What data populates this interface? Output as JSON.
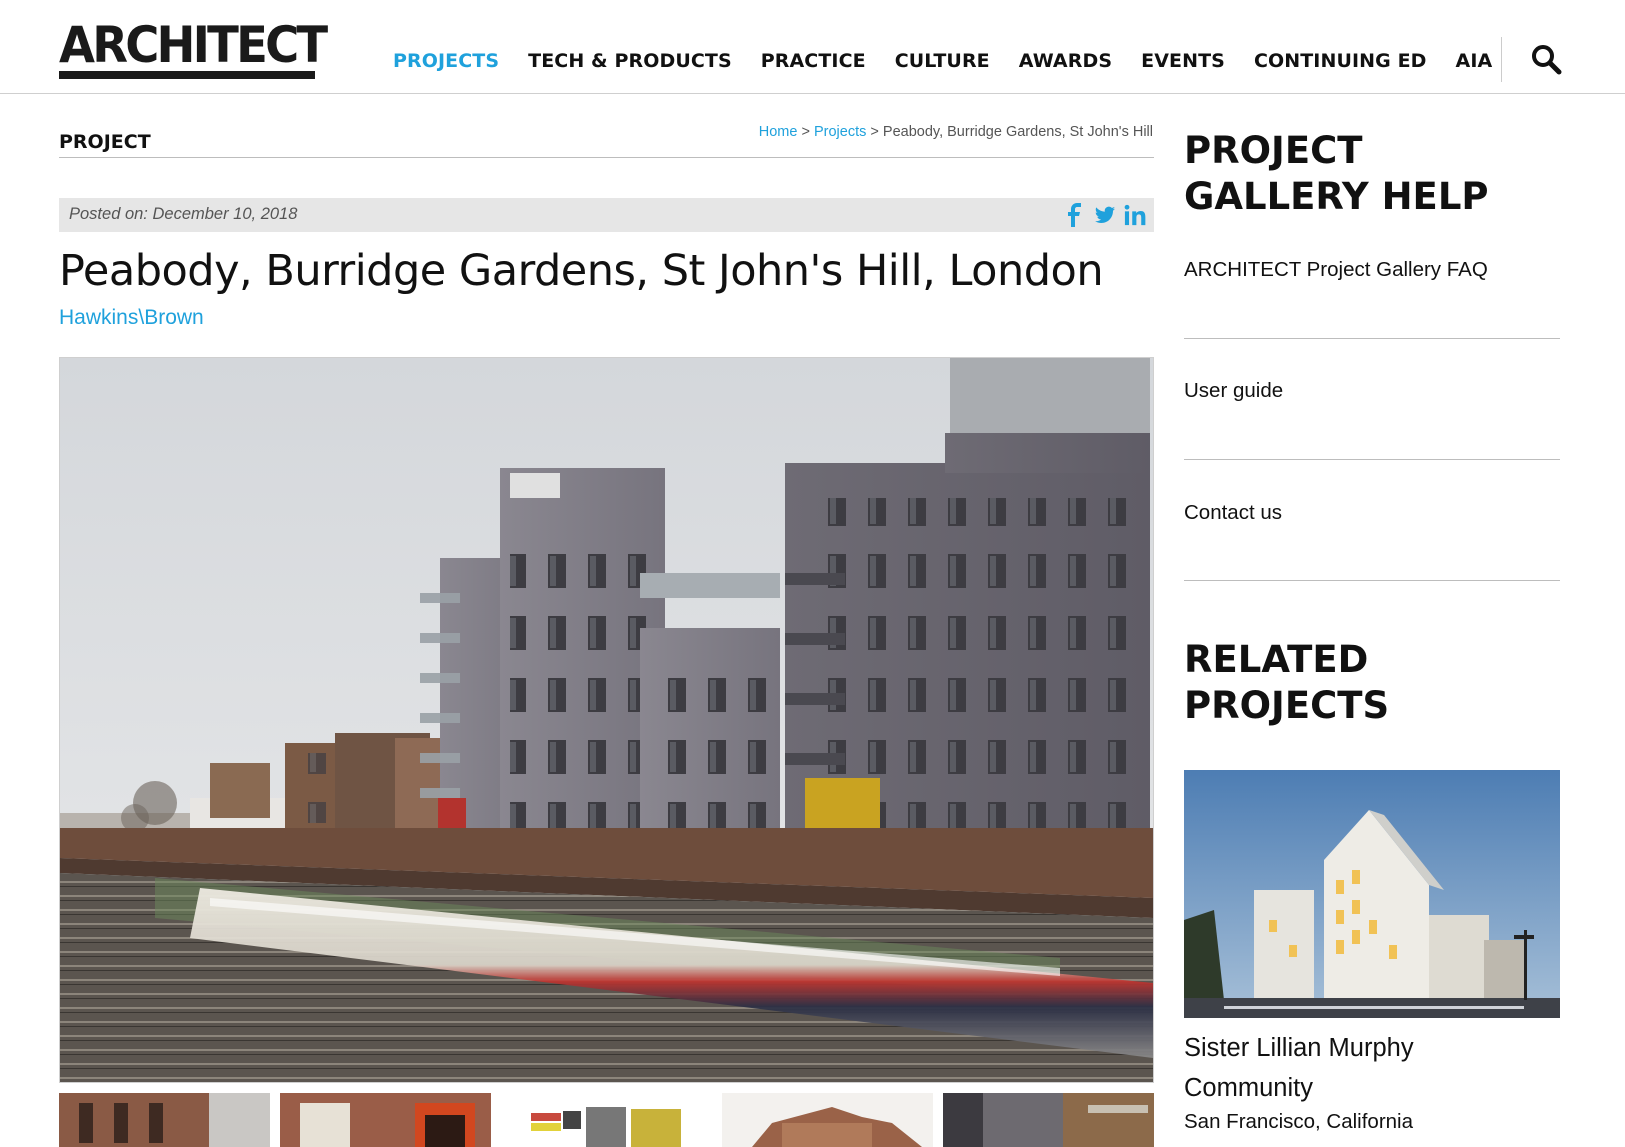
{
  "header": {
    "logo": "ARCHITECT",
    "nav": [
      {
        "label": "PROJECTS",
        "active": true
      },
      {
        "label": "TECH & PRODUCTS",
        "active": false
      },
      {
        "label": "PRACTICE",
        "active": false
      },
      {
        "label": "CULTURE",
        "active": false
      },
      {
        "label": "AWARDS",
        "active": false
      },
      {
        "label": "EVENTS",
        "active": false
      },
      {
        "label": "CONTINUING ED",
        "active": false
      },
      {
        "label": "AIA",
        "active": false
      }
    ],
    "search_icon": "search-icon"
  },
  "main": {
    "section_label": "PROJECT",
    "breadcrumb": {
      "home": "Home",
      "sep1": " > ",
      "projects": "Projects",
      "sep2": " > ",
      "current": "Peabody, Burridge Gardens, St John's Hill"
    },
    "posted": "Posted on: December 10, 2018",
    "share_icons": [
      "facebook-icon",
      "twitter-icon",
      "linkedin-icon"
    ],
    "title": "Peabody, Burridge Gardens, St John's Hill, London",
    "firm": "Hawkins\\Brown",
    "thumbnail_count": 5
  },
  "sidebar": {
    "help_heading": [
      "PROJECT",
      "GALLERY HELP"
    ],
    "help_links": [
      "ARCHITECT Project Gallery FAQ",
      "User guide",
      "Contact us"
    ],
    "related_heading": [
      "RELATED",
      "PROJECTS"
    ],
    "related": {
      "title_lines": [
        "Sister Lillian Murphy",
        "Community"
      ],
      "location": "San Francisco, California"
    }
  },
  "colors": {
    "accent": "#1fa1dc",
    "text": "#111111",
    "posted_bar": "#e6e6e6"
  }
}
